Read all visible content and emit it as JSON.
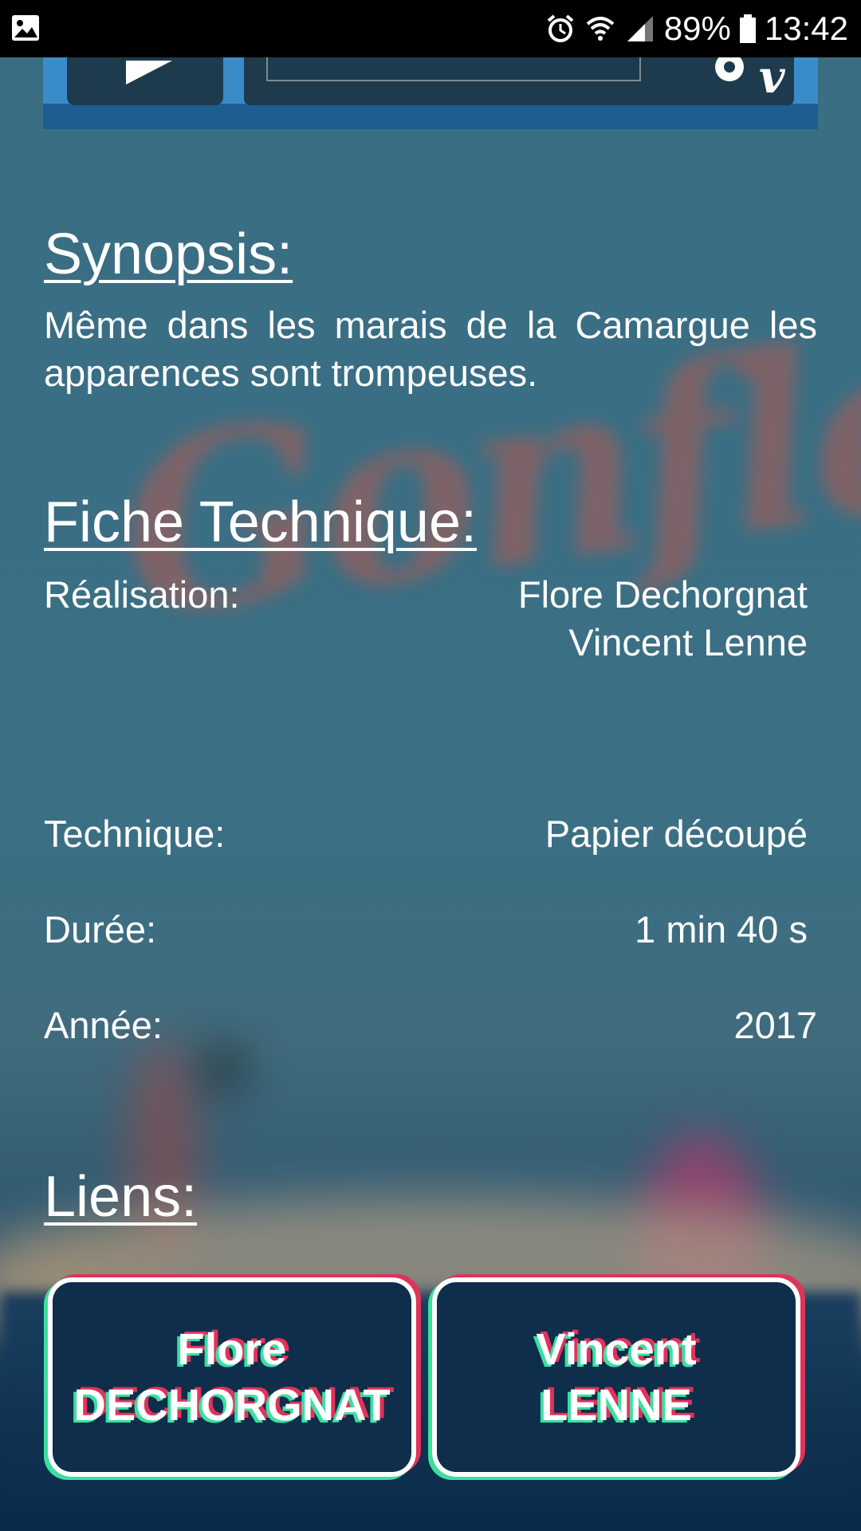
{
  "status_bar": {
    "battery_percent": "89%",
    "time": "13:42"
  },
  "synopsis": {
    "title": "Synopsis:",
    "text": "Même dans les marais de la Camargue les apparences sont trompeuses."
  },
  "fiche": {
    "title": "Fiche Technique:",
    "realisation_label": "Réalisation:",
    "realisation_names": [
      "Flore Dechorgnat",
      "Vincent Lenne"
    ],
    "technique_label": "Technique:",
    "technique_value": "Papier découpé",
    "duree_label": "Durée:",
    "duree_value": "1 min 40 s",
    "annee_label": "Année:",
    "annee_value": "2017"
  },
  "liens": {
    "title": "Liens:",
    "buttons": [
      {
        "line1": "Flore",
        "line2": "DECHORGNAT"
      },
      {
        "line1": "Vincent",
        "line2": "LENNE"
      }
    ]
  },
  "colors": {
    "background": "#3b6e84",
    "player_blue": "#3a8cc9",
    "button_fill": "#0e2e4c",
    "accent_green": "#3ae0a0",
    "accent_red": "#e0325a"
  }
}
